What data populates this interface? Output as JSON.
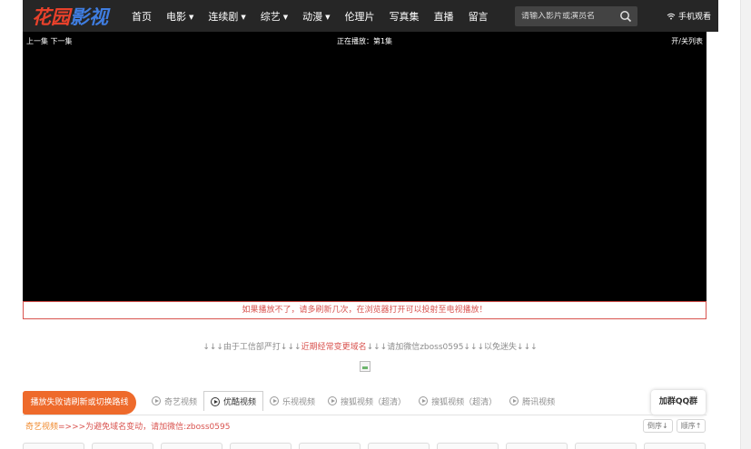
{
  "header": {
    "logo_part1": "花园",
    "logo_part2": "影视",
    "nav": [
      {
        "label": "首页",
        "dropdown": false
      },
      {
        "label": "电影",
        "dropdown": true
      },
      {
        "label": "连续剧",
        "dropdown": true
      },
      {
        "label": "综艺",
        "dropdown": true
      },
      {
        "label": "动漫",
        "dropdown": true
      },
      {
        "label": "伦理片",
        "dropdown": false
      },
      {
        "label": "写真集",
        "dropdown": false
      },
      {
        "label": "直播",
        "dropdown": false
      },
      {
        "label": "留言",
        "dropdown": false
      }
    ],
    "search_placeholder": "请输入影片或演员名",
    "mobile_label": "手机观看"
  },
  "player": {
    "prev_label": "上一集",
    "next_label": "下一集",
    "now_playing": "正在播放：第1集",
    "toggle_list": "开/关列表"
  },
  "notice": "如果播放不了，请多刷新几次，在浏览器打开可以投射至电视播放！",
  "info": {
    "part1": "↓↓↓由于工信部严打↓↓↓",
    "highlight": "近期经常变更域名",
    "part2": "↓↓↓请加微信zboss0595↓↓↓以免迷失↓↓↓"
  },
  "switch_button": "播放失败请刷新或切换路线",
  "sources": [
    {
      "label": "奇艺视频",
      "active": false
    },
    {
      "label": "优酷视频",
      "active": true
    },
    {
      "label": "乐视视频",
      "active": false
    },
    {
      "label": "搜狐视频（超清）",
      "active": false
    },
    {
      "label": "搜狐视频（超清）",
      "active": false
    },
    {
      "label": "腾讯视频",
      "active": false
    }
  ],
  "qq_button": "加群QQ群",
  "note": {
    "source_name": "奇艺视频",
    "text": "=>>>为避免域名变动，请加微信:zboss0595"
  },
  "sort": {
    "desc": "倒序↓",
    "asc": "顺序↑"
  },
  "colors": {
    "header_bg": "#262626",
    "accent_orange": "#ee6a2b",
    "alert_red": "#d9534f"
  }
}
